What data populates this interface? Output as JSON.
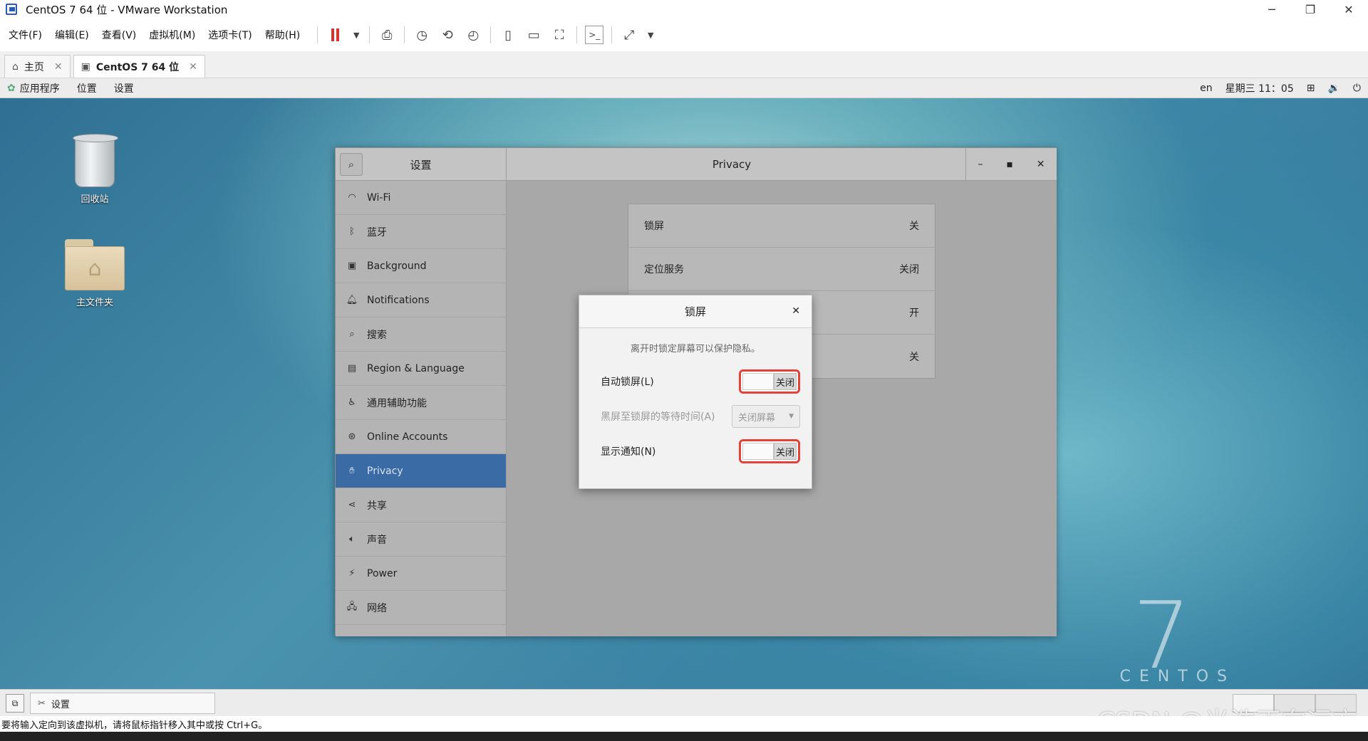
{
  "window": {
    "title": "CentOS 7 64 位 - VMware Workstation",
    "controls": [
      "─",
      "❐",
      "✕"
    ]
  },
  "menu": [
    "文件(F)",
    "编辑(E)",
    "查看(V)",
    "虚拟机(M)",
    "选项卡(T)",
    "帮助(H)"
  ],
  "tabs": [
    {
      "label": "主页",
      "icon": "home-icon"
    },
    {
      "label": "CentOS 7 64 位",
      "icon": "vm-icon",
      "active": true
    }
  ],
  "gnome_top": {
    "apps": "应用程序",
    "places": "位置",
    "settings": "设置",
    "lang": "en",
    "clock": "星期三 11：05"
  },
  "desktop": {
    "trash_label": "回收站",
    "home_label": "主文件夹",
    "brand_number": "7",
    "brand_word": "CENTOS"
  },
  "settings": {
    "left_title": "设置",
    "right_title": "Privacy",
    "sidebar": [
      {
        "label": "Wi-Fi",
        "icon": "wifi-icon"
      },
      {
        "label": "蓝牙",
        "icon": "bluetooth-icon"
      },
      {
        "label": "Background",
        "icon": "background-icon"
      },
      {
        "label": "Notifications",
        "icon": "bell-icon"
      },
      {
        "label": "搜索",
        "icon": "search-icon"
      },
      {
        "label": "Region & Language",
        "icon": "region-icon"
      },
      {
        "label": "通用辅助功能",
        "icon": "accessibility-icon"
      },
      {
        "label": "Online Accounts",
        "icon": "online-accounts-icon"
      },
      {
        "label": "Privacy",
        "icon": "privacy-hand-icon",
        "active": true
      },
      {
        "label": "共享",
        "icon": "share-icon"
      },
      {
        "label": "声音",
        "icon": "sound-icon"
      },
      {
        "label": "Power",
        "icon": "power-icon"
      },
      {
        "label": "网络",
        "icon": "network-icon"
      }
    ],
    "privacy_rows": [
      {
        "label": "锁屏",
        "value": "关"
      },
      {
        "label": "定位服务",
        "value": "关闭"
      },
      {
        "label": "",
        "value": "开"
      },
      {
        "label": "",
        "value": "关"
      }
    ]
  },
  "dialog": {
    "title": "锁屏",
    "description": "离开时锁定屏幕可以保护隐私。",
    "auto_lock_label": "自动锁屏(L)",
    "auto_lock_state": "关闭",
    "delay_label": "黑屏至锁屏的等待时间(A)",
    "delay_value": "关闭屏幕",
    "notify_label": "显示通知(N)",
    "notify_state": "关闭"
  },
  "taskbar": {
    "task_label": "设置"
  },
  "statusbar": {
    "text": "要将输入定向到该虚拟机，请将鼠标指针移入其中或按 Ctrl+G。"
  },
  "watermark": "CSDN @光浩正向远方"
}
